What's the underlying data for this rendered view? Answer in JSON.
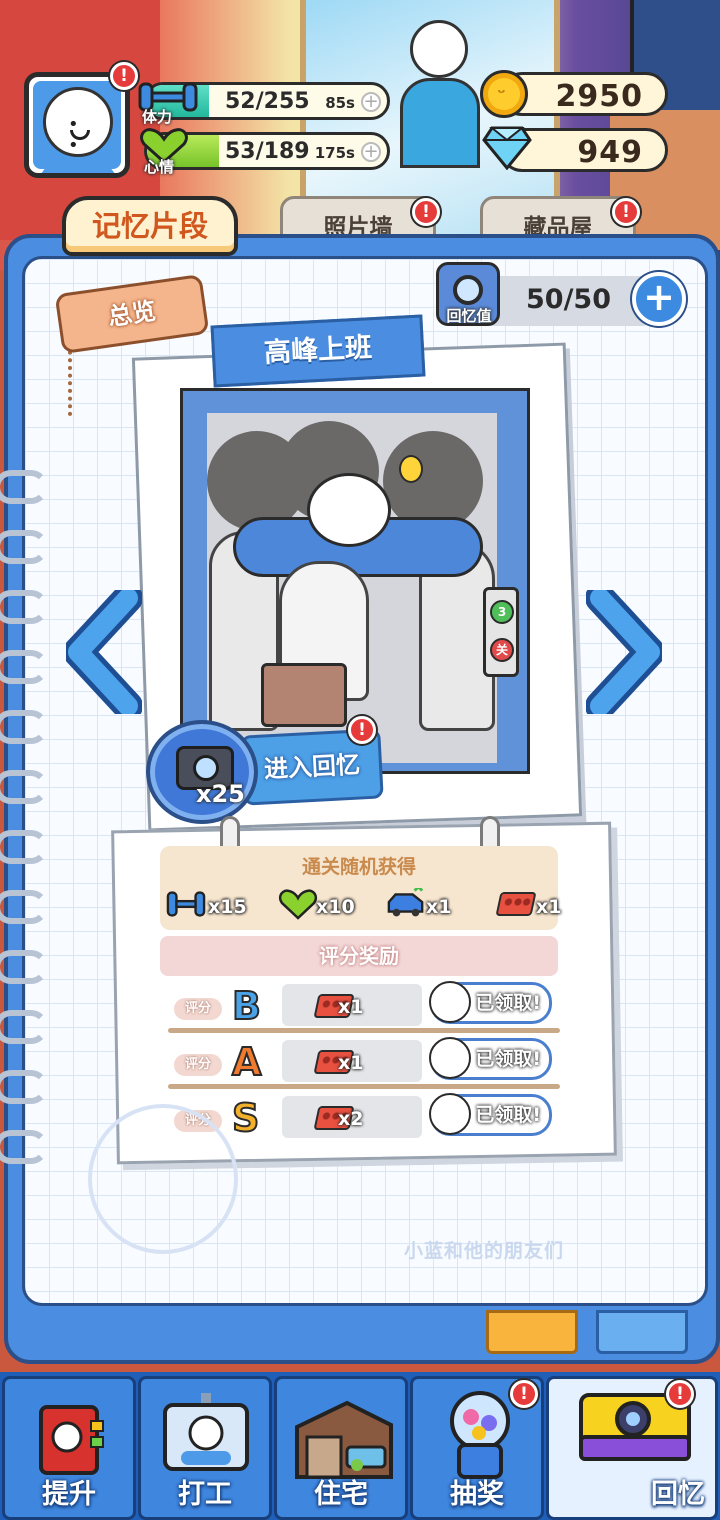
{
  "hud": {
    "stamina": {
      "label": "体力",
      "value": "52/255",
      "timer": "85s",
      "fill": 0.204
    },
    "mood": {
      "label": "心情",
      "value": "53/189",
      "timer": "175s",
      "fill": 0.28
    },
    "coins": "2950",
    "gems": "949"
  },
  "tabs": [
    {
      "label": "记忆片段",
      "active": true
    },
    {
      "label": "照片墙",
      "active": false
    },
    {
      "label": "藏品屋",
      "active": false
    }
  ],
  "overview": {
    "label": "总览"
  },
  "memory_value": {
    "label": "回忆值",
    "value": "50/50"
  },
  "episode": {
    "title": "高峰上班",
    "panel_buttons": [
      "3",
      "关"
    ],
    "enter_button": "进入回忆",
    "camera_cost": "x25"
  },
  "rewards": {
    "random_title": "通关随机获得",
    "random_items": [
      {
        "icon": "dumbbell-icon",
        "qty": "x15"
      },
      {
        "icon": "heart-icon",
        "qty": "x10"
      },
      {
        "icon": "car-icon",
        "qty": "x1"
      },
      {
        "icon": "brick-icon",
        "qty": "x1"
      }
    ],
    "score_title": "评分奖励",
    "score_rows": [
      {
        "label": "评分",
        "grade": "B",
        "grade_color": "#4aa3e8",
        "qty": "x1",
        "status": "已领取!"
      },
      {
        "label": "评分",
        "grade": "A",
        "grade_color": "#f07a2e",
        "qty": "x1",
        "status": "已领取!"
      },
      {
        "label": "评分",
        "grade": "S",
        "grade_color": "#f3b12b",
        "qty": "x2",
        "status": "已领取!"
      }
    ]
  },
  "watermark": "小蓝和他的朋友们",
  "nav": [
    {
      "label": "提升",
      "icon": "book-icon",
      "badge": false
    },
    {
      "label": "打工",
      "icon": "id-badge-icon",
      "badge": false
    },
    {
      "label": "住宅",
      "icon": "house-icon",
      "badge": false
    },
    {
      "label": "抽奖",
      "icon": "gacha-icon",
      "badge": true
    },
    {
      "label": "回忆",
      "icon": "camera-icon",
      "badge": true,
      "active": true
    }
  ],
  "colors": {
    "accent": "#4b8de0",
    "badge": "#e53b3b",
    "tab_active_text": "#d0571e"
  }
}
